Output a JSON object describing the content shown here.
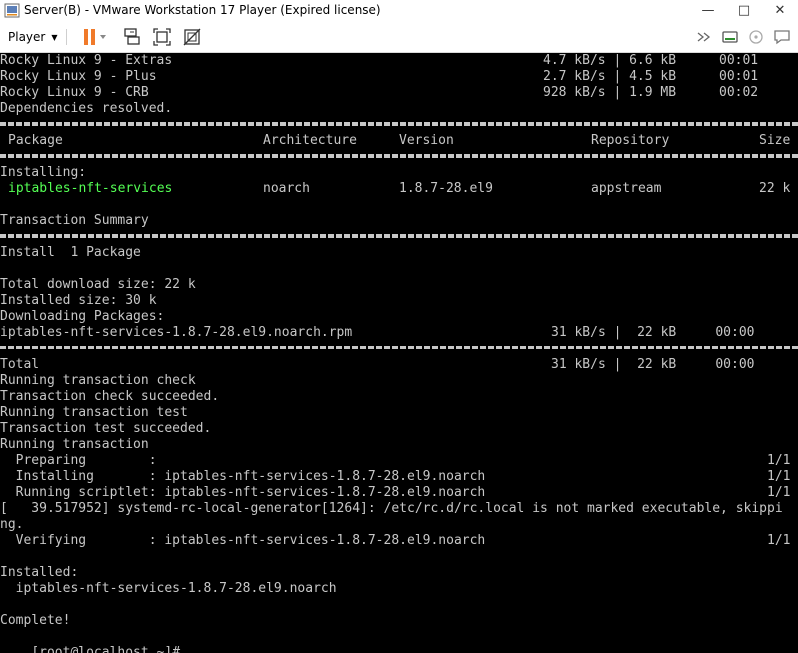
{
  "window": {
    "title": "Server(B) - VMware Workstation 17 Player (Expired license)",
    "minimize": "—",
    "maximize": "□",
    "close": "✕"
  },
  "toolbar": {
    "player_label": "Player",
    "icons": [
      "pause-icon",
      "send-ctrl-alt-del-icon",
      "fit-guest-icon",
      "unity-icon",
      "forward-icon",
      "removable-devices-icon",
      "cd-icon",
      "message-icon"
    ]
  },
  "terminal": {
    "repo_lines": [
      {
        "name": "Rocky Linux 9 - Extras",
        "speed": "4.7 kB/s | 6.6 kB",
        "time": "00:01"
      },
      {
        "name": "Rocky Linux 9 - Plus",
        "speed": "2.7 kB/s | 4.5 kB",
        "time": "00:01"
      },
      {
        "name": "Rocky Linux 9 - CRB",
        "speed": "928 kB/s | 1.9 MB",
        "time": "00:02"
      }
    ],
    "deps_resolved": "Dependencies resolved.",
    "table_headers": {
      "package": "Package",
      "arch": "Architecture",
      "version": "Version",
      "repo": "Repository",
      "size": "Size"
    },
    "installing_label": "Installing:",
    "package_row": {
      "package": "iptables-nft-services",
      "arch": "noarch",
      "version": "1.8.7-28.el9",
      "repo": "appstream",
      "size": "22 k"
    },
    "transaction_summary": "Transaction Summary",
    "install_count": "Install  1 Package",
    "total_download": "Total download size: 22 k",
    "installed_size": "Installed size: 30 k",
    "downloading": "Downloading Packages:",
    "rpm_line": {
      "file": "iptables-nft-services-1.8.7-28.el9.noarch.rpm",
      "stats": "31 kB/s |  22 kB     00:00"
    },
    "total_line": {
      "label": "Total",
      "stats": "31 kB/s |  22 kB     00:00"
    },
    "txn_check": "Running transaction check",
    "txn_check_ok": "Transaction check succeeded.",
    "txn_test": "Running transaction test",
    "txn_test_ok": "Transaction test succeeded.",
    "txn_run": "Running transaction",
    "steps": [
      {
        "text": "  Preparing        :",
        "count": "1/1"
      },
      {
        "text": "  Installing       : iptables-nft-services-1.8.7-28.el9.noarch",
        "count": "1/1"
      },
      {
        "text": "  Running scriptlet: iptables-nft-services-1.8.7-28.el9.noarch",
        "count": "1/1"
      }
    ],
    "kernel_msg": "[   39.517952] systemd-rc-local-generator[1264]: /etc/rc.d/rc.local is not marked executable, skipping.",
    "kernel_msg_line1": "[   39.517952] systemd-rc-local-generator[1264]: /etc/rc.d/rc.local is not marked executable, skippi",
    "kernel_msg_line2": "ng.",
    "verifying": {
      "text": "  Verifying        : iptables-nft-services-1.8.7-28.el9.noarch",
      "count": "1/1"
    },
    "installed_label": "Installed:",
    "installed_pkg": "  iptables-nft-services-1.8.7-28.el9.noarch",
    "complete": "Complete!",
    "prompt": "[root@localhost ~]# "
  }
}
